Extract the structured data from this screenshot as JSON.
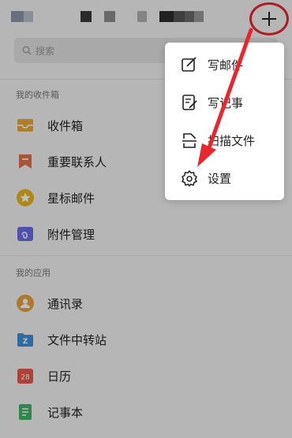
{
  "colors": {
    "accent_red": "#e8262d"
  },
  "header": {
    "title_redacted": true,
    "add_icon": "plus-icon"
  },
  "search": {
    "placeholder": "搜索",
    "icon": "search-icon"
  },
  "mailboxes": {
    "section_label": "我的收件箱",
    "items": [
      {
        "label": "收件箱",
        "icon": "inbox-icon"
      },
      {
        "label": "重要联系人",
        "icon": "bookmark-icon"
      },
      {
        "label": "星标邮件",
        "icon": "star-icon"
      },
      {
        "label": "附件管理",
        "icon": "attachment-icon"
      }
    ]
  },
  "apps": {
    "section_label": "我的应用",
    "items": [
      {
        "label": "通讯录",
        "icon": "contacts-icon"
      },
      {
        "label": "文件中转站",
        "icon": "file-transfer-icon"
      },
      {
        "label": "日历",
        "icon": "calendar-icon",
        "badge": "28"
      },
      {
        "label": "记事本",
        "icon": "notepad-icon"
      }
    ]
  },
  "popup_menu": {
    "items": [
      {
        "label": "写邮件",
        "icon": "compose-mail-icon"
      },
      {
        "label": "写记事",
        "icon": "compose-note-icon"
      },
      {
        "label": "扫描文件",
        "icon": "scan-document-icon"
      },
      {
        "label": "设置",
        "icon": "settings-gear-icon"
      }
    ]
  }
}
